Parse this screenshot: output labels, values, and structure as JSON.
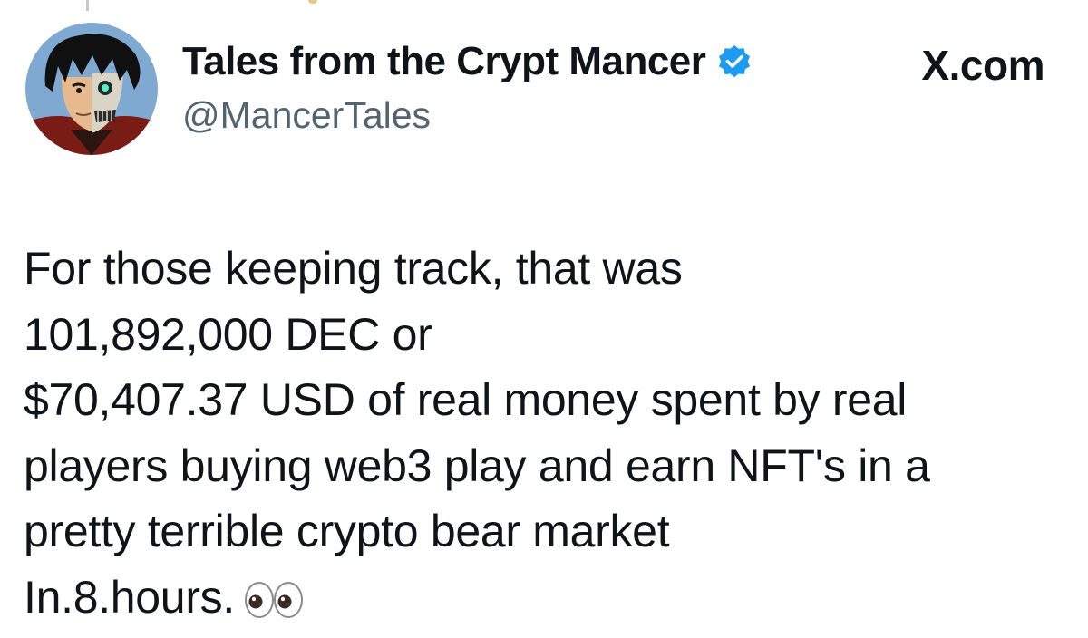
{
  "author": {
    "display_name": "Tales from the Crypt Mancer",
    "handle": "@MancerTales",
    "verified": true,
    "avatar_icon": "skull-anime-avatar"
  },
  "site": {
    "label": "X.com",
    "icon": "x-logo-icon"
  },
  "tweet": {
    "lines": [
      "For those keeping track, that was",
      "101,892,000 DEC or",
      "$70,407.37 USD of real money spent by real",
      "players buying web3 play and earn NFT's in a",
      "pretty terrible crypto bear market",
      "In.8.hours."
    ],
    "trailing_emoji": "eyes-emoji"
  },
  "colors": {
    "text": "#0f1419",
    "secondary_text": "#536471",
    "verified_blue": "#1d9bf0"
  }
}
